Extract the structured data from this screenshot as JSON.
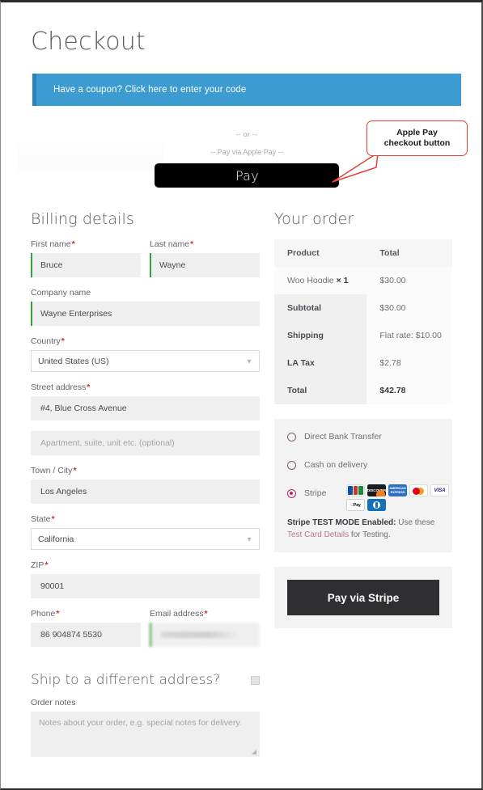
{
  "page": {
    "title": "Checkout"
  },
  "coupon": {
    "text": "Have a coupon? Click here to enter your code"
  },
  "express_checkout": {
    "or_separator": "-- or --",
    "pay_via_label": "-- Pay via Apple Pay --",
    "apple_glyph": "",
    "apple_pay_label": "Pay"
  },
  "callout": {
    "line1": "Apple Pay",
    "line2": "checkout button",
    "border_color": "#e8413a"
  },
  "billing": {
    "title": "Billing details",
    "required_mark": "*",
    "fields": {
      "first_name": {
        "label": "First name",
        "value": "Bruce",
        "required": true,
        "valid": true
      },
      "last_name": {
        "label": "Last name",
        "value": "Wayne",
        "required": true,
        "valid": true
      },
      "company": {
        "label": "Company name",
        "value": "Wayne Enterprises",
        "required": false,
        "valid": true
      },
      "country": {
        "label": "Country",
        "value": "United States (US)",
        "required": true
      },
      "street": {
        "label": "Street address",
        "value": "#4, Blue Cross Avenue",
        "required": true
      },
      "apartment": {
        "label": "",
        "placeholder": "Apartment, suite, unit etc. (optional)",
        "value": ""
      },
      "city": {
        "label": "Town / City",
        "value": "Los Angeles",
        "required": true
      },
      "state": {
        "label": "State",
        "value": "California",
        "required": true
      },
      "zip": {
        "label": "ZIP",
        "value": "90001",
        "required": true
      },
      "phone": {
        "label": "Phone",
        "value": "86 904874 5530",
        "required": true
      },
      "email": {
        "label": "Email address",
        "value": "",
        "required": true,
        "valid": true,
        "redacted": true
      }
    }
  },
  "shipping": {
    "title": "Ship to a different address?",
    "checked": false
  },
  "order_notes": {
    "label": "Order notes",
    "placeholder": "Notes about your order, e.g. special notes for delivery.",
    "value": ""
  },
  "order": {
    "title": "Your order",
    "headers": {
      "product": "Product",
      "total": "Total"
    },
    "line_items": [
      {
        "name": "Woo Hoodie",
        "qty": "× 1",
        "total": "$30.00"
      }
    ],
    "summary": [
      {
        "label": "Subtotal",
        "value": "$30.00",
        "emphasis": false
      },
      {
        "label": "Shipping",
        "value": "Flat rate: $10.00",
        "emphasis": false
      },
      {
        "label": "LA Tax",
        "value": "$2.78",
        "emphasis": false
      },
      {
        "label": "Total",
        "value": "$42.78",
        "emphasis": true
      }
    ]
  },
  "payment": {
    "methods": [
      {
        "id": "bacs",
        "label": "Direct Bank Transfer",
        "selected": false
      },
      {
        "id": "cod",
        "label": "Cash on delivery",
        "selected": false
      },
      {
        "id": "stripe",
        "label": "Stripe",
        "selected": true
      }
    ],
    "cards": [
      {
        "name": "jcb-card-icon",
        "label": "JCB"
      },
      {
        "name": "discover-card-icon",
        "label": "DISCOVER"
      },
      {
        "name": "amex-card-icon",
        "label": "AMERICAN EXPRESS"
      },
      {
        "name": "mastercard-card-icon",
        "label": "mastercard"
      },
      {
        "name": "visa-card-icon",
        "label": "VISA"
      },
      {
        "name": "applepay-card-icon",
        "label": "Pay"
      },
      {
        "name": "diners-card-icon",
        "label": "Diners Club"
      }
    ],
    "test_mode": {
      "bold": "Stripe TEST MODE Enabled:",
      "after_bold": " Use these ",
      "link": "Test Card Details",
      "tail": " for Testing."
    },
    "submit_label": "Pay via Stripe",
    "selected_accent": "#b5286e"
  }
}
